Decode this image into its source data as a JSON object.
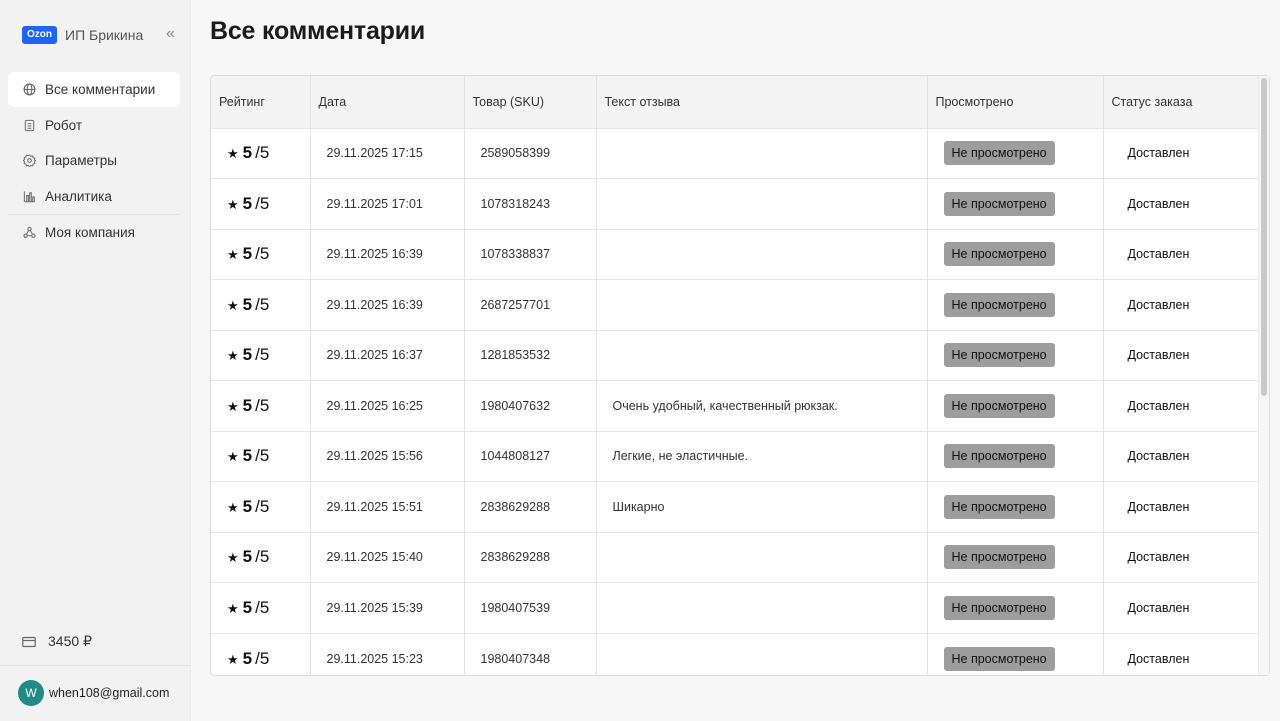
{
  "brand": {
    "badge": "Ozon",
    "name": "ИП Брикина"
  },
  "nav": [
    {
      "label": "Все комментарии",
      "icon": "globe-icon",
      "active": true
    },
    {
      "label": "Робот",
      "icon": "robot-icon"
    },
    {
      "label": "Параметры",
      "icon": "gear-icon"
    },
    {
      "label": "Аналитика",
      "icon": "chart-icon"
    },
    {
      "label": "Моя компания",
      "icon": "company-icon"
    }
  ],
  "balance": {
    "amount": "3450 ₽",
    "icon": "wallet-icon"
  },
  "user": {
    "initial": "W",
    "email": "when108@gmail.com"
  },
  "page": {
    "title": "Все комментарии"
  },
  "table": {
    "headers": [
      "Рейтинг",
      "Дата",
      "Товар (SKU)",
      "Текст отзыва",
      "Просмотрено",
      "Статус заказа"
    ],
    "rows": [
      {
        "rating_star": "★",
        "rating": "5",
        "rating_max": "/5",
        "date": "29.11.2025 17:15",
        "sku": "2589058399",
        "text": "",
        "viewed": "Не просмотрено",
        "status": "Доставлен"
      },
      {
        "rating_star": "★",
        "rating": "5",
        "rating_max": "/5",
        "date": "29.11.2025 17:01",
        "sku": "1078318243",
        "text": "",
        "viewed": "Не просмотрено",
        "status": "Доставлен"
      },
      {
        "rating_star": "★",
        "rating": "5",
        "rating_max": "/5",
        "date": "29.11.2025 16:39",
        "sku": "1078338837",
        "text": "",
        "viewed": "Не просмотрено",
        "status": "Доставлен"
      },
      {
        "rating_star": "★",
        "rating": "5",
        "rating_max": "/5",
        "date": "29.11.2025 16:39",
        "sku": "2687257701",
        "text": "",
        "viewed": "Не просмотрено",
        "status": "Доставлен"
      },
      {
        "rating_star": "★",
        "rating": "5",
        "rating_max": "/5",
        "date": "29.11.2025 16:37",
        "sku": "1281853532",
        "text": "",
        "viewed": "Не просмотрено",
        "status": "Доставлен"
      },
      {
        "rating_star": "★",
        "rating": "5",
        "rating_max": "/5",
        "date": "29.11.2025 16:25",
        "sku": "1980407632",
        "text": "Очень удобный, качественный рюкзак.",
        "viewed": "Не просмотрено",
        "status": "Доставлен"
      },
      {
        "rating_star": "★",
        "rating": "5",
        "rating_max": "/5",
        "date": "29.11.2025 15:56",
        "sku": "1044808127",
        "text": "Легкие, не эластичные.",
        "viewed": "Не просмотрено",
        "status": "Доставлен"
      },
      {
        "rating_star": "★",
        "rating": "5",
        "rating_max": "/5",
        "date": "29.11.2025 15:51",
        "sku": "2838629288",
        "text": "Шикарно",
        "viewed": "Не просмотрено",
        "status": "Доставлен"
      },
      {
        "rating_star": "★",
        "rating": "5",
        "rating_max": "/5",
        "date": "29.11.2025 15:40",
        "sku": "2838629288",
        "text": "",
        "viewed": "Не просмотрено",
        "status": "Доставлен"
      },
      {
        "rating_star": "★",
        "rating": "5",
        "rating_max": "/5",
        "date": "29.11.2025 15:39",
        "sku": "1980407539",
        "text": "",
        "viewed": "Не просмотрено",
        "status": "Доставлен"
      },
      {
        "rating_star": "★",
        "rating": "5",
        "rating_max": "/5",
        "date": "29.11.2025 15:23",
        "sku": "1980407348",
        "text": "",
        "viewed": "Не просмотрено",
        "status": "Доставлен"
      }
    ]
  },
  "colors": {
    "brand_blue": "#1e64f5",
    "badge_gray": "#9d9d9d",
    "avatar_teal": "#1f8a86"
  }
}
